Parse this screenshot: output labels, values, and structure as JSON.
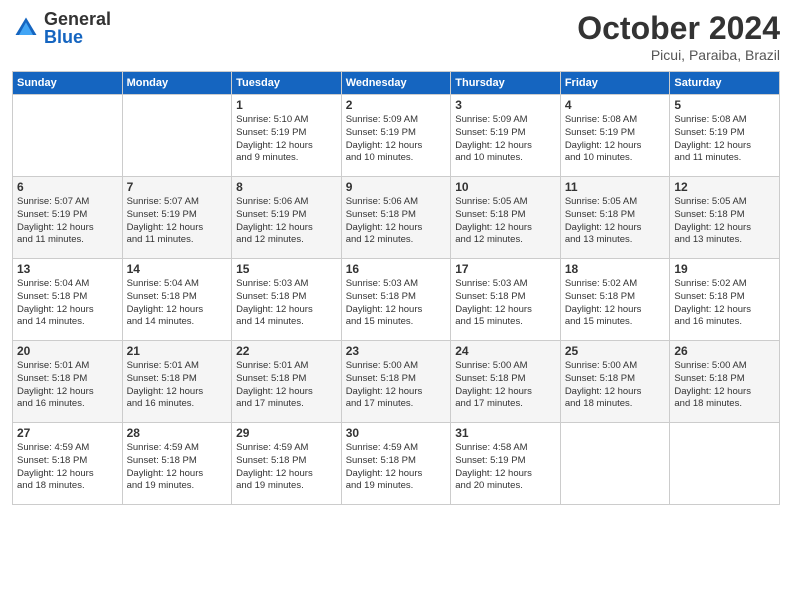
{
  "header": {
    "logo_general": "General",
    "logo_blue": "Blue",
    "month": "October 2024",
    "location": "Picui, Paraiba, Brazil"
  },
  "weekdays": [
    "Sunday",
    "Monday",
    "Tuesday",
    "Wednesday",
    "Thursday",
    "Friday",
    "Saturday"
  ],
  "weeks": [
    [
      {
        "day": "",
        "info": ""
      },
      {
        "day": "",
        "info": ""
      },
      {
        "day": "1",
        "info": "Sunrise: 5:10 AM\nSunset: 5:19 PM\nDaylight: 12 hours\nand 9 minutes."
      },
      {
        "day": "2",
        "info": "Sunrise: 5:09 AM\nSunset: 5:19 PM\nDaylight: 12 hours\nand 10 minutes."
      },
      {
        "day": "3",
        "info": "Sunrise: 5:09 AM\nSunset: 5:19 PM\nDaylight: 12 hours\nand 10 minutes."
      },
      {
        "day": "4",
        "info": "Sunrise: 5:08 AM\nSunset: 5:19 PM\nDaylight: 12 hours\nand 10 minutes."
      },
      {
        "day": "5",
        "info": "Sunrise: 5:08 AM\nSunset: 5:19 PM\nDaylight: 12 hours\nand 11 minutes."
      }
    ],
    [
      {
        "day": "6",
        "info": "Sunrise: 5:07 AM\nSunset: 5:19 PM\nDaylight: 12 hours\nand 11 minutes."
      },
      {
        "day": "7",
        "info": "Sunrise: 5:07 AM\nSunset: 5:19 PM\nDaylight: 12 hours\nand 11 minutes."
      },
      {
        "day": "8",
        "info": "Sunrise: 5:06 AM\nSunset: 5:19 PM\nDaylight: 12 hours\nand 12 minutes."
      },
      {
        "day": "9",
        "info": "Sunrise: 5:06 AM\nSunset: 5:18 PM\nDaylight: 12 hours\nand 12 minutes."
      },
      {
        "day": "10",
        "info": "Sunrise: 5:05 AM\nSunset: 5:18 PM\nDaylight: 12 hours\nand 12 minutes."
      },
      {
        "day": "11",
        "info": "Sunrise: 5:05 AM\nSunset: 5:18 PM\nDaylight: 12 hours\nand 13 minutes."
      },
      {
        "day": "12",
        "info": "Sunrise: 5:05 AM\nSunset: 5:18 PM\nDaylight: 12 hours\nand 13 minutes."
      }
    ],
    [
      {
        "day": "13",
        "info": "Sunrise: 5:04 AM\nSunset: 5:18 PM\nDaylight: 12 hours\nand 14 minutes."
      },
      {
        "day": "14",
        "info": "Sunrise: 5:04 AM\nSunset: 5:18 PM\nDaylight: 12 hours\nand 14 minutes."
      },
      {
        "day": "15",
        "info": "Sunrise: 5:03 AM\nSunset: 5:18 PM\nDaylight: 12 hours\nand 14 minutes."
      },
      {
        "day": "16",
        "info": "Sunrise: 5:03 AM\nSunset: 5:18 PM\nDaylight: 12 hours\nand 15 minutes."
      },
      {
        "day": "17",
        "info": "Sunrise: 5:03 AM\nSunset: 5:18 PM\nDaylight: 12 hours\nand 15 minutes."
      },
      {
        "day": "18",
        "info": "Sunrise: 5:02 AM\nSunset: 5:18 PM\nDaylight: 12 hours\nand 15 minutes."
      },
      {
        "day": "19",
        "info": "Sunrise: 5:02 AM\nSunset: 5:18 PM\nDaylight: 12 hours\nand 16 minutes."
      }
    ],
    [
      {
        "day": "20",
        "info": "Sunrise: 5:01 AM\nSunset: 5:18 PM\nDaylight: 12 hours\nand 16 minutes."
      },
      {
        "day": "21",
        "info": "Sunrise: 5:01 AM\nSunset: 5:18 PM\nDaylight: 12 hours\nand 16 minutes."
      },
      {
        "day": "22",
        "info": "Sunrise: 5:01 AM\nSunset: 5:18 PM\nDaylight: 12 hours\nand 17 minutes."
      },
      {
        "day": "23",
        "info": "Sunrise: 5:00 AM\nSunset: 5:18 PM\nDaylight: 12 hours\nand 17 minutes."
      },
      {
        "day": "24",
        "info": "Sunrise: 5:00 AM\nSunset: 5:18 PM\nDaylight: 12 hours\nand 17 minutes."
      },
      {
        "day": "25",
        "info": "Sunrise: 5:00 AM\nSunset: 5:18 PM\nDaylight: 12 hours\nand 18 minutes."
      },
      {
        "day": "26",
        "info": "Sunrise: 5:00 AM\nSunset: 5:18 PM\nDaylight: 12 hours\nand 18 minutes."
      }
    ],
    [
      {
        "day": "27",
        "info": "Sunrise: 4:59 AM\nSunset: 5:18 PM\nDaylight: 12 hours\nand 18 minutes."
      },
      {
        "day": "28",
        "info": "Sunrise: 4:59 AM\nSunset: 5:18 PM\nDaylight: 12 hours\nand 19 minutes."
      },
      {
        "day": "29",
        "info": "Sunrise: 4:59 AM\nSunset: 5:18 PM\nDaylight: 12 hours\nand 19 minutes."
      },
      {
        "day": "30",
        "info": "Sunrise: 4:59 AM\nSunset: 5:18 PM\nDaylight: 12 hours\nand 19 minutes."
      },
      {
        "day": "31",
        "info": "Sunrise: 4:58 AM\nSunset: 5:19 PM\nDaylight: 12 hours\nand 20 minutes."
      },
      {
        "day": "",
        "info": ""
      },
      {
        "day": "",
        "info": ""
      }
    ]
  ]
}
